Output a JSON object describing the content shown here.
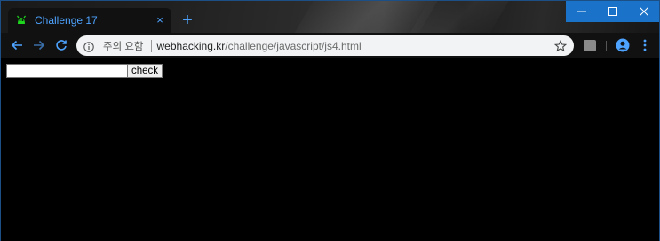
{
  "browser": {
    "tab": {
      "title": "Challenge 17",
      "favicon": "green-bug-icon",
      "close_glyph": "×"
    },
    "new_tab_glyph": "+",
    "window_controls": {
      "minimize_glyph": "—",
      "maximize_glyph": "☐",
      "close_glyph": "✕"
    },
    "omnibox": {
      "security_label": "주의 요함",
      "url_host": "webhacking.kr",
      "url_path": "/challenge/javascript/js4.html"
    },
    "colors": {
      "accent": "#4da3ff",
      "window_controls": "#1a73c8",
      "favicon": "#1ed61e"
    }
  },
  "page": {
    "input": {
      "value": "",
      "placeholder": ""
    },
    "check_button_label": "check"
  }
}
